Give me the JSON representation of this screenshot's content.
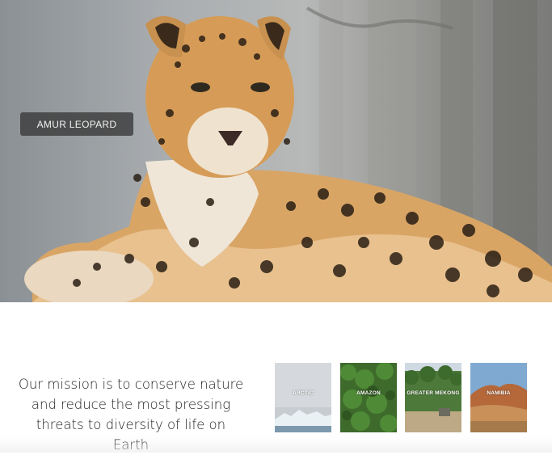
{
  "hero": {
    "label": "AMUR LEOPARD"
  },
  "mission": {
    "text": "Our mission is to conserve nature and reduce the most pressing threats to diversity of life on Earth"
  },
  "places": [
    {
      "label": "ARCTIC"
    },
    {
      "label": "AMAZON"
    },
    {
      "label": "GREATER MEKONG"
    },
    {
      "label": "NAMIBIA"
    }
  ]
}
